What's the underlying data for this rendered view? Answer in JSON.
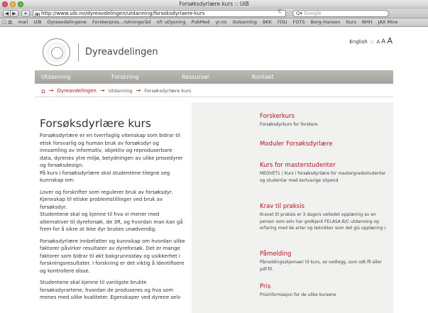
{
  "window": {
    "title": "Forsøksdyrlære kurs :: UiB"
  },
  "toolbar": {
    "back": "◀",
    "forward": "▶",
    "add": "+",
    "url": "http://www.uib.no/dyreavdelingen/utdanning/forsoksdyrlaere-kurs",
    "reload": "C",
    "search_placeholder": "Google"
  },
  "bookmarks": {
    "items": [
      "mail",
      "UiB",
      "Dyreavdelingene",
      "Forskerpros…rskningsråd",
      "nfr utlysning",
      "PubMed",
      "yr.no",
      "itslearning",
      "BKK",
      "FDU",
      "FOTS",
      "Berg-Hansen",
      "Kurs",
      "NHH",
      "JAX Mice"
    ]
  },
  "lang": {
    "english": "English",
    "sep": "::",
    "a1": "A",
    "a2": "A",
    "a3": "A"
  },
  "site": {
    "name": "Dyreavdelingen"
  },
  "nav": {
    "utdanning": "Utdanning",
    "forskning": "Forskning",
    "ressurser": "Ressurser",
    "kontakt": "Kontakt"
  },
  "breadcrumb": {
    "dyreavdelingen": "Dyreavdelingen",
    "utdanning": "Utdanning",
    "current": "Forsøksdyrlære kurs"
  },
  "content": {
    "title": "Forsøksdyrlære kurs",
    "paragraphs": [
      "Forsøksdyrlære er en tverrfaglig vitenskap som bidrar til etisk forsvarlig og human bruk av forsøksdyr og innsamling av informativ, objektiv og reproduserbare data, dyrenes ytre miljø, betydningen av ulike prosedyrer og forsøksdesign.",
      "På kurs i forsøksdyrlære skal studentene tilegne seg kunnskap om:",
      "Lover og forskrifter som regulerer bruk av forsøksdyr. Kjennskap til etiske problemstillinger ved bruk av forsøksdyr.",
      "Studentene skal og kjenne til hva vi mener med alternativer til dyreforsøk, de 3R, og hvordan man kan gå frem for å sikre at ikke dyr brukes unødvendig.",
      "Forsøksdyrlære innbefatter og kunnskap om hvordan ulike faktorer påvirker resultater av dyreforsøk. Det er mange faktorer som bidrar til økt bakgrunnsstøy og usikkerhet i forskningsresultater. I forskning er det viktig å identifisere og kontrollere disse.",
      "Studentene skal kjenne til vanligste brukte forsøksdyrartene, hvordan de produseres og hva som menes med ulike kvaliteter. Egenskaper ved dyrene selv"
    ]
  },
  "sidebar": {
    "items": [
      {
        "title": "Forskerkurs",
        "desc": "Forsøksdyrkurs for forskere"
      },
      {
        "title": "Moduler Forsøksdyrlære",
        "desc": ""
      },
      {
        "title": "Kurs for masterstudenter",
        "desc": "MEDVET1 / Kurs i forsøksdyrlære for mastergradsstudenter og studentar med kortvarige stipend"
      },
      {
        "title": "Krav til praksis",
        "desc": "Kravet til praksis er 3 dagers veiledet opplæring av en person som selv har godkjent FELASA B/C utdanning og erfaring med de arter og teknikker som det gis opplæring i."
      },
      {
        "title": "Påmelding",
        "desc": "Påmeldingsskjemaer til kurs, se vedlegg, som odt-fil eller pdf-fil."
      },
      {
        "title": "Pris",
        "desc": "Prisinformasjon for de ulike kursene"
      }
    ]
  }
}
